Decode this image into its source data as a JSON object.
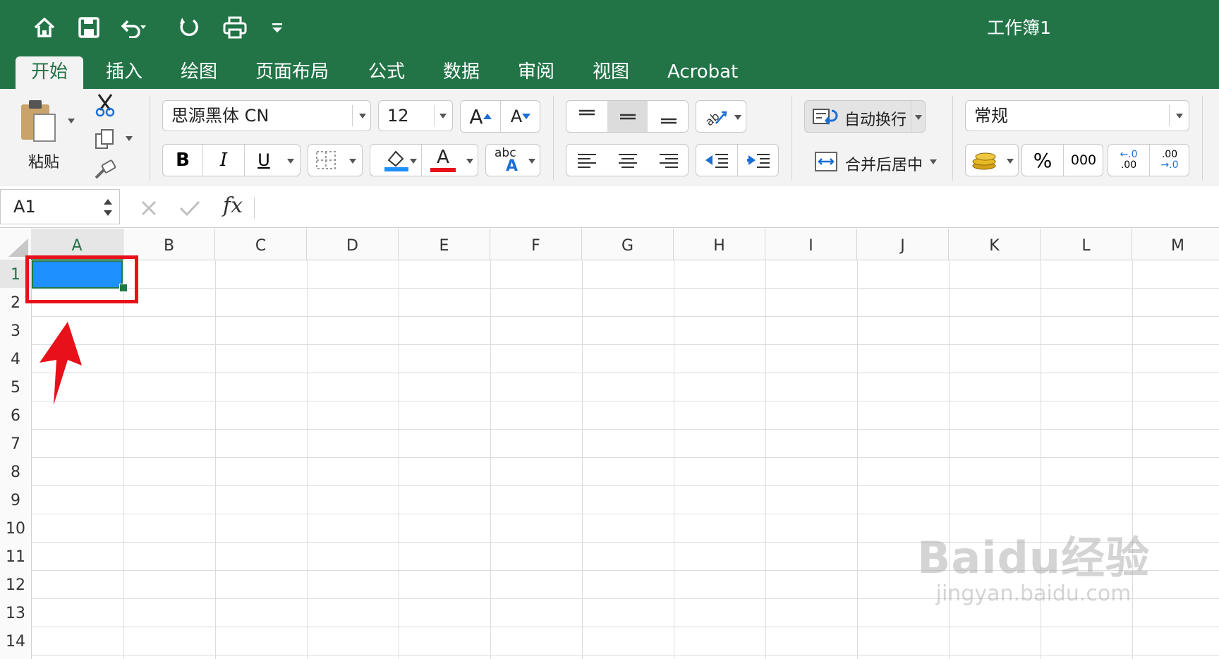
{
  "window": {
    "title": "工作簿1"
  },
  "quick_access": [
    "home-icon",
    "save-icon",
    "undo-icon",
    "redo-icon",
    "print-icon",
    "customize-icon"
  ],
  "tabs": [
    {
      "label": "开始",
      "active": true
    },
    {
      "label": "插入"
    },
    {
      "label": "绘图"
    },
    {
      "label": "页面布局"
    },
    {
      "label": "公式"
    },
    {
      "label": "数据"
    },
    {
      "label": "审阅"
    },
    {
      "label": "视图"
    },
    {
      "label": "Acrobat"
    }
  ],
  "ribbon": {
    "paste_label": "粘贴",
    "font_name": "思源黑体 CN",
    "font_size": "12",
    "wrap_text": "自动换行",
    "merge_center": "合并后居中",
    "number_format": "常规",
    "percent": "%",
    "thousands": "000",
    "increase_decimal_top": "←.0",
    "increase_decimal_bottom": ".00",
    "decrease_decimal_top": ".00",
    "decrease_decimal_bottom": "→.0",
    "bold": "B",
    "italic": "I",
    "underline": "U",
    "abc": "abc",
    "font_color_letter": "A",
    "grow_font": "A",
    "shrink_font": "A",
    "fill_color": "#1e90ff",
    "font_color": "#e8111a"
  },
  "formula_bar": {
    "name_box": "A1",
    "fx": "fx",
    "formula": ""
  },
  "grid": {
    "columns": [
      "A",
      "B",
      "C",
      "D",
      "E",
      "F",
      "G",
      "H",
      "I",
      "J",
      "K",
      "L",
      "M"
    ],
    "rows": [
      "1",
      "2",
      "3",
      "4",
      "5",
      "6",
      "7",
      "8",
      "9",
      "10",
      "11",
      "12",
      "13",
      "14"
    ],
    "selected_cell": "A1",
    "accent_green": "#217346",
    "highlight_color": "#e8111a"
  },
  "watermark": {
    "brand": "Baidu经验",
    "url": "jingyan.baidu.com"
  }
}
